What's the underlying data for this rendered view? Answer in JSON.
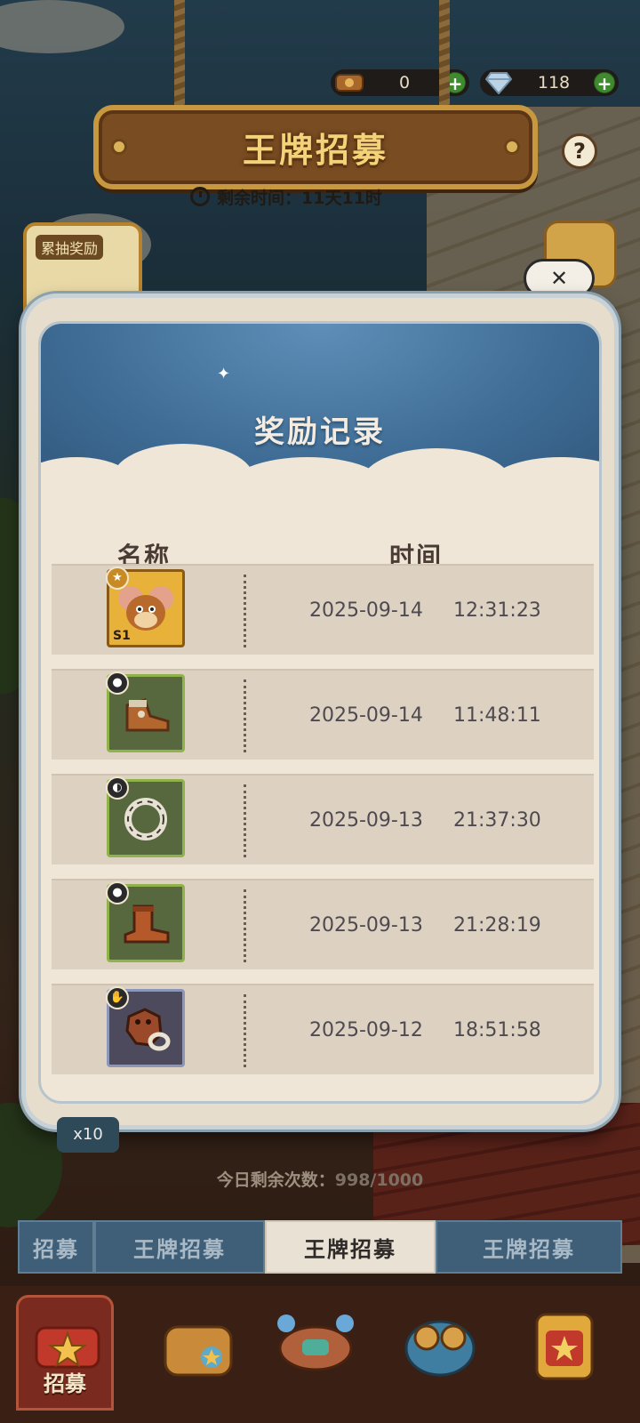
{
  "currency": [
    {
      "icon": "coin-icon",
      "value": "0"
    },
    {
      "icon": "diamond-icon",
      "value": "118"
    }
  ],
  "header": {
    "title": "王牌招募",
    "help": "?",
    "timer": "剩余时间：11天11时"
  },
  "side": {
    "reward_label": "累抽奖励"
  },
  "modal": {
    "title": "奖励记录",
    "columns": {
      "name": "名称",
      "time": "时间"
    },
    "records": [
      {
        "icon": "jerry-s1-portrait-icon",
        "badge": "S1",
        "date": "2025-09-14",
        "time": "12:31:23"
      },
      {
        "icon": "shoe-item-icon",
        "badge": "",
        "date": "2025-09-14",
        "time": "11:48:11"
      },
      {
        "icon": "bone-ring-icon",
        "badge": "",
        "date": "2025-09-13",
        "time": "21:37:30"
      },
      {
        "icon": "boot-item-icon",
        "badge": "",
        "date": "2025-09-13",
        "time": "21:28:19"
      },
      {
        "icon": "glove-item-icon",
        "badge": "",
        "date": "2025-09-12",
        "time": "18:51:58"
      }
    ]
  },
  "bottom": {
    "x10": "x10",
    "daily_label": "今日剩余次数：",
    "daily_value": "998/1000",
    "tabs": [
      "招募",
      "王牌招募",
      "王牌招募",
      "王牌招募"
    ],
    "nav": [
      {
        "label": "招募",
        "icon": "recruit-chest-icon"
      },
      {
        "label": "",
        "icon": "treasure-box-icon"
      },
      {
        "label": "",
        "icon": "machine-icon"
      },
      {
        "label": "",
        "icon": "goggles-icon"
      },
      {
        "label": "",
        "icon": "star-box-icon"
      }
    ]
  },
  "colors": {
    "sky": "#3f6d96",
    "panel": "#efe6d7",
    "row": "#ddd2c2",
    "gold": "#f4d27a"
  }
}
